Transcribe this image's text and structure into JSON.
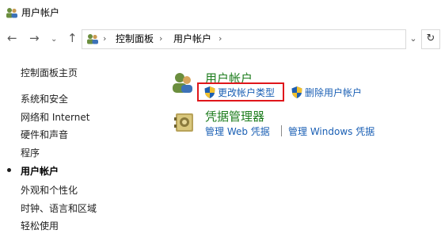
{
  "window": {
    "title": "用户帐户"
  },
  "nav": {
    "back": "←",
    "forward": "→",
    "recent": "⌄",
    "up": "↑",
    "refresh": "↻",
    "dropdown": "⌄"
  },
  "breadcrumb": {
    "items": [
      "控制面板",
      "用户帐户"
    ],
    "separator": "›"
  },
  "sidebar": {
    "items": [
      {
        "label": "控制面板主页",
        "active": false
      },
      {
        "label": "系统和安全",
        "active": false
      },
      {
        "label": "网络和 Internet",
        "active": false
      },
      {
        "label": "硬件和声音",
        "active": false
      },
      {
        "label": "程序",
        "active": false
      },
      {
        "label": "用户帐户",
        "active": true
      },
      {
        "label": "外观和个性化",
        "active": false
      },
      {
        "label": "时钟、语言和区域",
        "active": false
      },
      {
        "label": "轻松使用",
        "active": false
      }
    ]
  },
  "sections": {
    "user_accounts": {
      "title": "用户帐户",
      "links": [
        "更改帐户类型",
        "删除用户帐户"
      ]
    },
    "credential_manager": {
      "title": "凭据管理器",
      "links": [
        "管理 Web 凭据",
        "管理 Windows 凭据"
      ]
    }
  },
  "colors": {
    "section_title": "#1e7d1e",
    "link": "#1a5fb4",
    "highlight": "#e0161b"
  }
}
